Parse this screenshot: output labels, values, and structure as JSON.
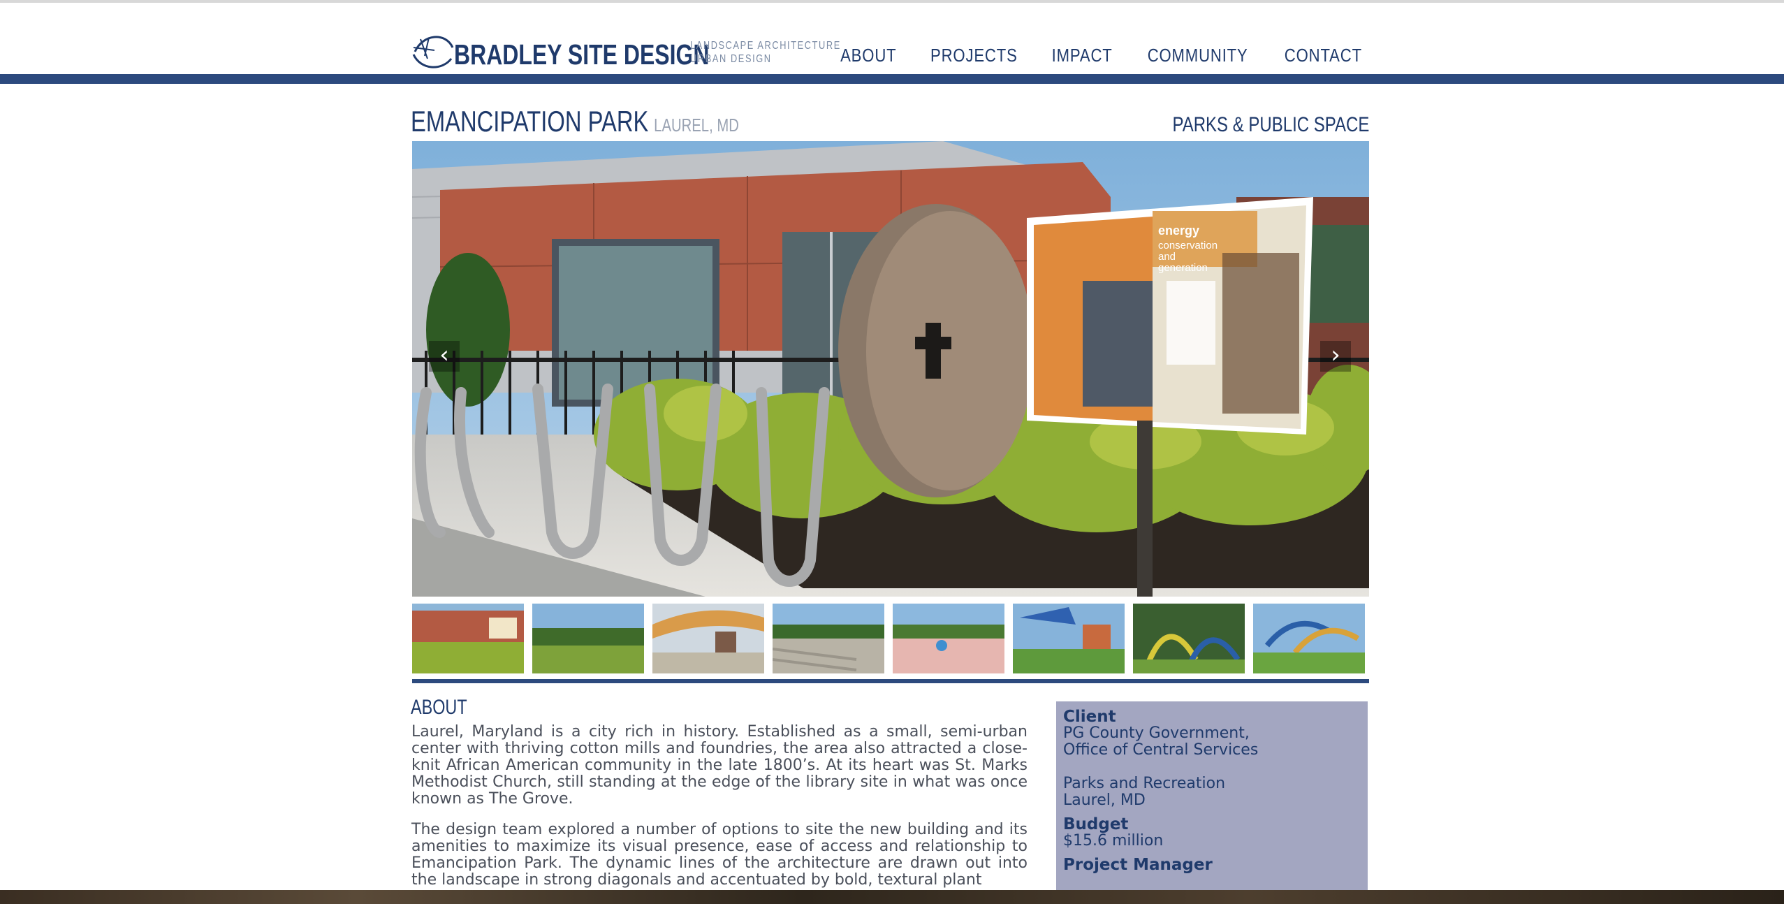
{
  "header": {
    "brand": "BRADLEY SITE DESIGN",
    "tagline_line1": "LANDSCAPE ARCHITECTURE",
    "tagline_line2": "URBAN DESIGN",
    "nav": [
      "ABOUT",
      "PROJECTS",
      "IMPACT",
      "COMMUNITY",
      "CONTACT"
    ]
  },
  "project": {
    "title": "EMANCIPATION PARK",
    "location": "LAUREL, MD",
    "category": "PARKS & PUBLIC SPACE"
  },
  "slideshow": {
    "prev_icon": "chevron-left-icon",
    "next_icon": "chevron-right-icon",
    "thumbnail_count": 8
  },
  "about": {
    "heading": "ABOUT",
    "paragraphs": [
      "Laurel, Maryland is a city rich in history. Established as a small, semi-urban center with thriving cotton mills and foundries, the area also attracted a close-knit African American community in the late 1800’s. At its heart was St. Marks Methodist Church, still standing at the edge of the library site in what was once known as The Grove.",
      "The design team explored a number of options to site the new building and its amenities to maximize its visual presence, ease of access and relationship to Emancipation Park. The dynamic lines of the architecture are drawn out into the landscape in strong diagonals and accentuated by bold, textural plant"
    ]
  },
  "info": {
    "client_label": "Client",
    "client_line1": "PG County Government,",
    "client_line2": "Office of Central Services",
    "client2_line1": "Parks and Recreation",
    "client2_line2": "Laurel, MD",
    "budget_label": "Budget",
    "budget_value": "$15.6 million",
    "pm_label": "Project Manager"
  },
  "colors": {
    "brand_navy": "#1f3a6b",
    "band": "#2c4a7e",
    "info_bg": "#a3a6c1"
  }
}
